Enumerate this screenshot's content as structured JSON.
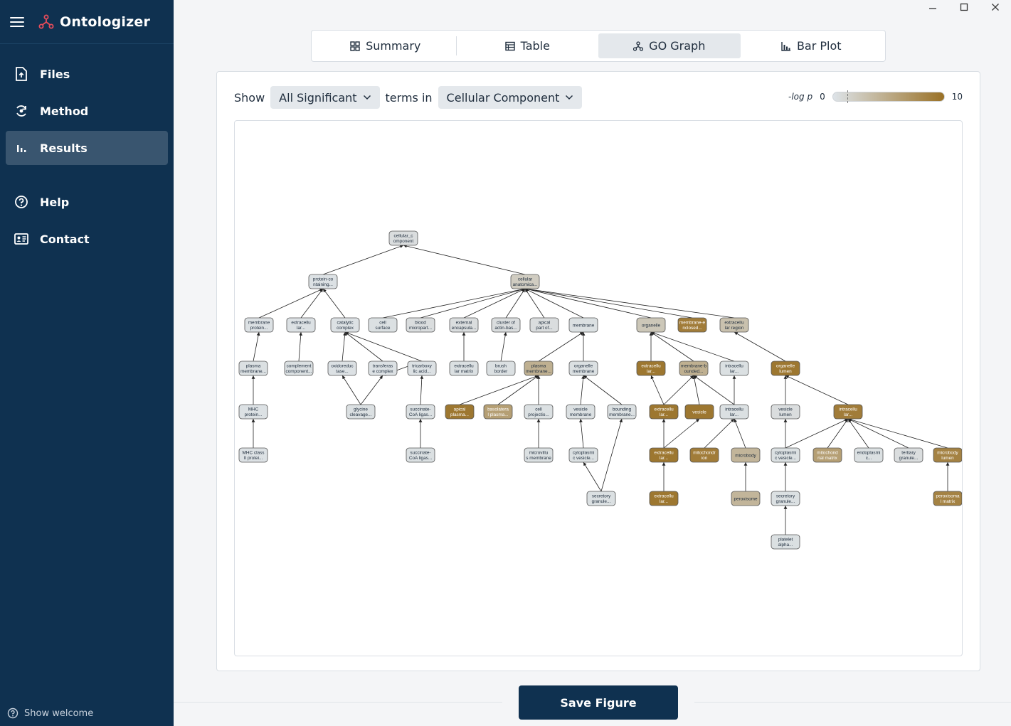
{
  "app": {
    "title": "Ontologizer"
  },
  "sidebar": {
    "items": [
      {
        "label": "Files",
        "icon": "file-upload-icon"
      },
      {
        "label": "Method",
        "icon": "method-icon"
      },
      {
        "label": "Results",
        "icon": "bar-chart-icon",
        "active": true
      },
      {
        "label": "Help",
        "icon": "help-icon"
      },
      {
        "label": "Contact",
        "icon": "contact-card-icon"
      }
    ],
    "show_welcome": "Show welcome"
  },
  "tabs": [
    {
      "label": "Summary",
      "icon": "grid-icon"
    },
    {
      "label": "Table",
      "icon": "table-icon"
    },
    {
      "label": "GO Graph",
      "icon": "graph-icon",
      "active": true
    },
    {
      "label": "Bar Plot",
      "icon": "bar-plot-icon"
    }
  ],
  "controls": {
    "show_label": "Show",
    "filter_value": "All Significant",
    "terms_in_label": "terms in",
    "ontology_value": "Cellular Component"
  },
  "legend": {
    "title": "-log p",
    "min": "0",
    "max": "10",
    "colors": {
      "low": "#dde3e8",
      "high": "#9a7126"
    }
  },
  "colors": {
    "sidebar": "#0f3150",
    "active_nav": "#39556f",
    "accent": "#c0392b"
  },
  "graph": {
    "nodes": [
      {
        "id": "n1",
        "l1": "cellular_c",
        "l2": "omponent",
        "c": 0.5
      },
      {
        "id": "n2",
        "l1": "protein-co",
        "l2": "ntaining...",
        "c": 0.2
      },
      {
        "id": "n3",
        "l1": "cellular",
        "l2": "anatomica...",
        "c": 2
      },
      {
        "id": "n4",
        "l1": "membrane",
        "l2": "protein...",
        "c": 0.2
      },
      {
        "id": "n5",
        "l1": "extracellu",
        "l2": "lar...",
        "c": 0.2
      },
      {
        "id": "n6",
        "l1": "catalytic",
        "l2": "complex",
        "c": 0.2
      },
      {
        "id": "n7",
        "l1": "cell",
        "l2": "surface",
        "c": 0.3
      },
      {
        "id": "n8",
        "l1": "blood",
        "l2": "micropart...",
        "c": 0.5
      },
      {
        "id": "n9",
        "l1": "external",
        "l2": "encapsula...",
        "c": 0.5
      },
      {
        "id": "n10",
        "l1": "cluster of",
        "l2": "actin-bas...",
        "c": 0.5
      },
      {
        "id": "n11",
        "l1": "apical",
        "l2": "part of...",
        "c": 0.5
      },
      {
        "id": "n12",
        "l1": "membrane",
        "l2": "",
        "c": 0.3
      },
      {
        "id": "n13",
        "l1": "organelle",
        "l2": "",
        "c": 2.5
      },
      {
        "id": "n14",
        "l1": "membrane-e",
        "l2": "nclosed...",
        "c": 9
      },
      {
        "id": "n15",
        "l1": "extracellu",
        "l2": "lar region",
        "c": 3
      },
      {
        "id": "n16",
        "l1": "plasma",
        "l2": "membrane...",
        "c": 0.3
      },
      {
        "id": "n17",
        "l1": "complement",
        "l2": "component...",
        "c": 0.3
      },
      {
        "id": "n18",
        "l1": "oxidoreduc",
        "l2": "tase...",
        "c": 0.2
      },
      {
        "id": "n19",
        "l1": "transferas",
        "l2": "e complex",
        "c": 0.2
      },
      {
        "id": "n20",
        "l1": "tricarboxy",
        "l2": "lic acid...",
        "c": 0.2
      },
      {
        "id": "n21",
        "l1": "extracellu",
        "l2": "lar matrix",
        "c": 0.3
      },
      {
        "id": "n22",
        "l1": "brush",
        "l2": "border",
        "c": 0.3
      },
      {
        "id": "n23",
        "l1": "plasma",
        "l2": "membrane...",
        "c": 4.5
      },
      {
        "id": "n24",
        "l1": "organelle",
        "l2": "membrane",
        "c": 0.3
      },
      {
        "id": "n25",
        "l1": "extracellu",
        "l2": "lar...",
        "c": 9.5
      },
      {
        "id": "n26",
        "l1": "membrane-b",
        "l2": "ounded...",
        "c": 4.5
      },
      {
        "id": "n27",
        "l1": "intracellu",
        "l2": "lar...",
        "c": 0.3
      },
      {
        "id": "n28",
        "l1": "organelle",
        "l2": "lumen",
        "c": 9.5
      },
      {
        "id": "n29",
        "l1": "MHC",
        "l2": "protein...",
        "c": 0.2
      },
      {
        "id": "n30",
        "l1": "glycine",
        "l2": "cleavage...",
        "c": 0.3
      },
      {
        "id": "n31",
        "l1": "succinate-",
        "l2": "CoA ligas...",
        "c": 0.3
      },
      {
        "id": "n32",
        "l1": "apical",
        "l2": "plasma...",
        "c": 9.5
      },
      {
        "id": "n33",
        "l1": "basolatera",
        "l2": "l plasma...",
        "c": 6
      },
      {
        "id": "n34",
        "l1": "cell",
        "l2": "projectio...",
        "c": 0.3
      },
      {
        "id": "n35",
        "l1": "vesicle",
        "l2": "membrane",
        "c": 0.3
      },
      {
        "id": "n36",
        "l1": "bounding",
        "l2": "membrane...",
        "c": 0.3
      },
      {
        "id": "n37",
        "l1": "extracellu",
        "l2": "lar...",
        "c": 9.5
      },
      {
        "id": "n38",
        "l1": "vesicle",
        "l2": "",
        "c": 9.5
      },
      {
        "id": "n39",
        "l1": "intracellu",
        "l2": "lar...",
        "c": 0.3
      },
      {
        "id": "n40",
        "l1": "vesicle",
        "l2": "lumen",
        "c": 0.5
      },
      {
        "id": "n41",
        "l1": "intracellu",
        "l2": "lar...",
        "c": 9
      },
      {
        "id": "n42",
        "l1": "MHC class",
        "l2": "II protei...",
        "c": 0.2
      },
      {
        "id": "n43",
        "l1": "succinate-",
        "l2": "CoA ligas...",
        "c": 0.3
      },
      {
        "id": "n44",
        "l1": "microvillu",
        "l2": "s membrane",
        "c": 0.3
      },
      {
        "id": "n45",
        "l1": "cytoplasmi",
        "l2": "c vesicle...",
        "c": 0.3
      },
      {
        "id": "n46",
        "l1": "extracellu",
        "l2": "lar...",
        "c": 9.5
      },
      {
        "id": "n47",
        "l1": "mitochondr",
        "l2": "ion",
        "c": 9
      },
      {
        "id": "n48",
        "l1": "microbody",
        "l2": "",
        "c": 4
      },
      {
        "id": "n49",
        "l1": "cytoplasmi",
        "l2": "c vesicle...",
        "c": 0.3
      },
      {
        "id": "n50",
        "l1": "mitochond",
        "l2": "rial matrix",
        "c": 6
      },
      {
        "id": "n51",
        "l1": "endoplasmi",
        "l2": "c...",
        "c": 0.3
      },
      {
        "id": "n52",
        "l1": "tertiary",
        "l2": "granule...",
        "c": 0.5
      },
      {
        "id": "n53",
        "l1": "microbody",
        "l2": "lumen",
        "c": 8.5
      },
      {
        "id": "n54",
        "l1": "secretory",
        "l2": "granule...",
        "c": 0.3
      },
      {
        "id": "n55",
        "l1": "extracellu",
        "l2": "lar...",
        "c": 9.5
      },
      {
        "id": "n56",
        "l1": "peroxisome",
        "l2": "",
        "c": 4
      },
      {
        "id": "n57",
        "l1": "secretory",
        "l2": "granule...",
        "c": 0.3
      },
      {
        "id": "n58",
        "l1": "peroxisoma",
        "l2": "l matrix",
        "c": 8.5
      },
      {
        "id": "n59",
        "l1": "platelet",
        "l2": "alpha...",
        "c": 0.3
      }
    ],
    "edges": [
      [
        "n2",
        "n1"
      ],
      [
        "n3",
        "n1"
      ],
      [
        "n4",
        "n2"
      ],
      [
        "n5",
        "n2"
      ],
      [
        "n6",
        "n2"
      ],
      [
        "n7",
        "n3"
      ],
      [
        "n8",
        "n3"
      ],
      [
        "n9",
        "n3"
      ],
      [
        "n10",
        "n3"
      ],
      [
        "n11",
        "n3"
      ],
      [
        "n12",
        "n3"
      ],
      [
        "n13",
        "n3"
      ],
      [
        "n14",
        "n3"
      ],
      [
        "n15",
        "n3"
      ],
      [
        "n16",
        "n4"
      ],
      [
        "n17",
        "n5"
      ],
      [
        "n18",
        "n6"
      ],
      [
        "n19",
        "n6"
      ],
      [
        "n20",
        "n6"
      ],
      [
        "n20",
        "n19"
      ],
      [
        "n21",
        "n9"
      ],
      [
        "n22",
        "n10"
      ],
      [
        "n23",
        "n12"
      ],
      [
        "n24",
        "n12"
      ],
      [
        "n25",
        "n13"
      ],
      [
        "n26",
        "n13"
      ],
      [
        "n27",
        "n13"
      ],
      [
        "n28",
        "n15"
      ],
      [
        "n29",
        "n16"
      ],
      [
        "n30",
        "n18"
      ],
      [
        "n30",
        "n19"
      ],
      [
        "n31",
        "n20"
      ],
      [
        "n32",
        "n23"
      ],
      [
        "n33",
        "n23"
      ],
      [
        "n34",
        "n23"
      ],
      [
        "n35",
        "n24"
      ],
      [
        "n36",
        "n24"
      ],
      [
        "n37",
        "n25"
      ],
      [
        "n37",
        "n26"
      ],
      [
        "n38",
        "n26"
      ],
      [
        "n39",
        "n26"
      ],
      [
        "n39",
        "n27"
      ],
      [
        "n40",
        "n28"
      ],
      [
        "n41",
        "n28"
      ],
      [
        "n42",
        "n29"
      ],
      [
        "n43",
        "n31"
      ],
      [
        "n44",
        "n34"
      ],
      [
        "n45",
        "n35"
      ],
      [
        "n46",
        "n37"
      ],
      [
        "n46",
        "n38"
      ],
      [
        "n47",
        "n39"
      ],
      [
        "n48",
        "n39"
      ],
      [
        "n49",
        "n40"
      ],
      [
        "n49",
        "n41"
      ],
      [
        "n50",
        "n41"
      ],
      [
        "n51",
        "n41"
      ],
      [
        "n52",
        "n41"
      ],
      [
        "n53",
        "n41"
      ],
      [
        "n54",
        "n45"
      ],
      [
        "n54",
        "n36"
      ],
      [
        "n55",
        "n46"
      ],
      [
        "n56",
        "n48"
      ],
      [
        "n57",
        "n49"
      ],
      [
        "n58",
        "n53"
      ],
      [
        "n59",
        "n57"
      ]
    ]
  },
  "save_button": "Save Figure"
}
